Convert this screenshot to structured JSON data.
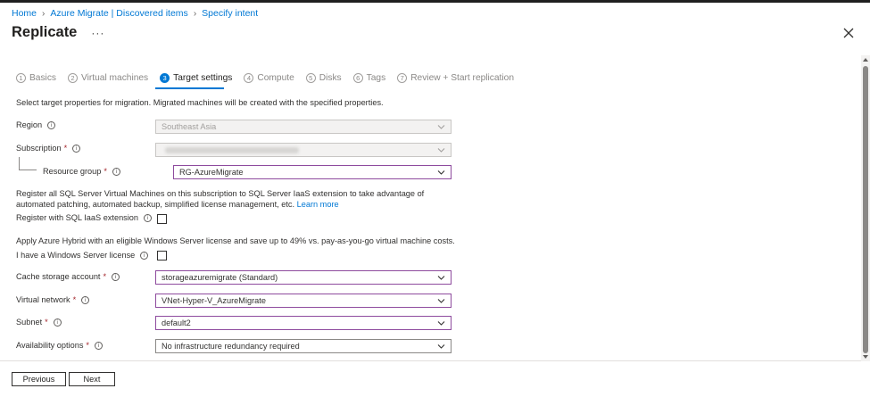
{
  "breadcrumb": [
    "Home",
    "Azure Migrate | Discovered items",
    "Specify intent"
  ],
  "page_title": "Replicate",
  "more_label": "···",
  "steps": [
    {
      "num": "1",
      "label": "Basics"
    },
    {
      "num": "2",
      "label": "Virtual machines"
    },
    {
      "num": "3",
      "label": "Target settings"
    },
    {
      "num": "4",
      "label": "Compute"
    },
    {
      "num": "5",
      "label": "Disks"
    },
    {
      "num": "6",
      "label": "Tags"
    },
    {
      "num": "7",
      "label": "Review + Start replication"
    }
  ],
  "active_step": "Target settings",
  "intro": "Select target properties for migration. Migrated machines will be created with the specified properties.",
  "form": {
    "region": {
      "label": "Region",
      "value": "Southeast Asia"
    },
    "subscription": {
      "label": "Subscription",
      "required": "*"
    },
    "resource_group": {
      "label": "Resource group",
      "required": "*",
      "value": "RG-AzureMigrate"
    },
    "sql_paragraph": "Register all SQL Server Virtual Machines on this subscription to SQL Server IaaS extension to take advantage of automated patching, automated backup, simplified license management, etc.",
    "sql_link": "Learn more",
    "sql_register": {
      "label": "Register with SQL IaaS extension"
    },
    "hybrid_paragraph": "Apply Azure Hybrid with an eligible Windows Server license and save up to 49% vs. pay-as-you-go virtual machine costs.",
    "windows_license": {
      "label": "I have a Windows Server license"
    },
    "cache_storage": {
      "label": "Cache storage account",
      "required": "*",
      "value": "storageazuremigrate (Standard)"
    },
    "virtual_network": {
      "label": "Virtual network",
      "required": "*",
      "value": "VNet-Hyper-V_AzureMigrate"
    },
    "subnet": {
      "label": "Subnet",
      "required": "*",
      "value": "default2"
    },
    "availability": {
      "label": "Availability options",
      "required": "*",
      "value": "No infrastructure redundancy required"
    }
  },
  "footer": {
    "previous": "Previous",
    "next": "Next"
  },
  "info_glyph": "i",
  "colors": {
    "accent": "#0078d4",
    "required": "#a4262c",
    "focus_border": "#8e4b9e"
  }
}
